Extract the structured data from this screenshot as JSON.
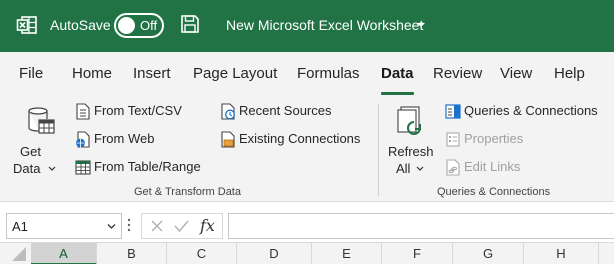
{
  "titlebar": {
    "app_icon": "excel-logo-icon",
    "autosave_label": "AutoSave",
    "autosave_state": "Off",
    "save_icon": "save-icon",
    "document_title": "New Microsoft Excel Worksheet",
    "background": "#217346"
  },
  "tabs": [
    {
      "label": "File"
    },
    {
      "label": "Home"
    },
    {
      "label": "Insert"
    },
    {
      "label": "Page Layout"
    },
    {
      "label": "Formulas"
    },
    {
      "label": "Data",
      "active": true
    },
    {
      "label": "Review"
    },
    {
      "label": "View"
    },
    {
      "label": "Help"
    }
  ],
  "ribbon": {
    "get_data": {
      "line1": "Get",
      "line2": "Data",
      "icon": "database-table-icon"
    },
    "from_text_csv": {
      "label": "From Text/CSV",
      "icon": "text-file-icon"
    },
    "from_web": {
      "label": "From Web",
      "icon": "web-file-icon"
    },
    "from_table_range": {
      "label": "From Table/Range",
      "icon": "table-icon"
    },
    "recent_sources": {
      "label": "Recent Sources",
      "icon": "recent-clock-icon"
    },
    "existing_connections": {
      "label": "Existing Connections",
      "icon": "connections-file-icon"
    },
    "group1_label": "Get & Transform Data",
    "refresh_all": {
      "line1": "Refresh",
      "line2": "All",
      "icon": "refresh-icon"
    },
    "queries_connections": {
      "label": "Queries & Connections",
      "icon": "queries-panel-icon"
    },
    "properties": {
      "label": "Properties",
      "icon": "properties-icon",
      "disabled": true
    },
    "edit_links": {
      "label": "Edit Links",
      "icon": "edit-links-icon",
      "disabled": true
    },
    "group2_label": "Queries & Connections"
  },
  "formula_bar": {
    "name_box": "A1",
    "fx": "fx",
    "formula": ""
  },
  "columns": [
    "A",
    "B",
    "C",
    "D",
    "E",
    "F",
    "G",
    "H"
  ],
  "selected_column": "A",
  "colors": {
    "accent": "#217346",
    "ribbon_bg": "#f3f3f3"
  }
}
